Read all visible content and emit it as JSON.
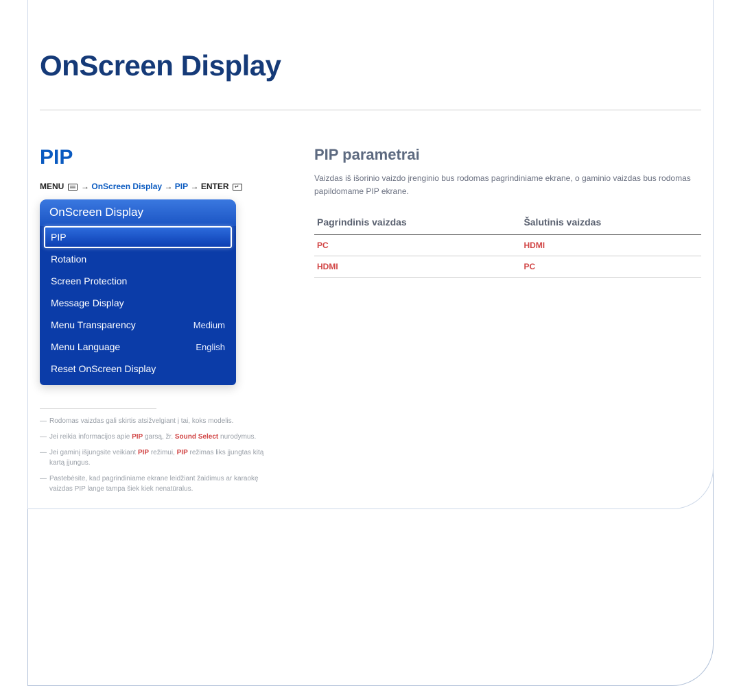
{
  "chapter_title": "OnScreen Display",
  "left": {
    "heading": "PIP",
    "breadcrumb": {
      "menu": "MENU",
      "path1": "OnScreen Display",
      "path2": "PIP",
      "enter": "ENTER",
      "arrow": "→"
    },
    "osd": {
      "title": "OnScreen Display",
      "items": [
        {
          "label": "PIP",
          "value": "",
          "selected": true
        },
        {
          "label": "Rotation",
          "value": "",
          "selected": false
        },
        {
          "label": "Screen Protection",
          "value": "",
          "selected": false
        },
        {
          "label": "Message Display",
          "value": "",
          "selected": false
        },
        {
          "label": "Menu Transparency",
          "value": "Medium",
          "selected": false
        },
        {
          "label": "Menu Language",
          "value": "English",
          "selected": false
        },
        {
          "label": "Reset OnScreen Display",
          "value": "",
          "selected": false
        }
      ]
    },
    "notes": {
      "n1": "Rodomas vaizdas gali skirtis atsižvelgiant į tai, koks modelis.",
      "n2_a": "Jei reikia informacijos apie ",
      "n2_hl1": "PIP",
      "n2_b": " garsą, žr. ",
      "n2_hl2": "Sound Select",
      "n2_c": " nurodymus.",
      "n3_a": "Jei gaminį išjungsite veikiant ",
      "n3_hl1": "PIP",
      "n3_b": " režimui, ",
      "n3_hl2": "PIP",
      "n3_c": " režimas liks įjungtas kitą kartą įjungus.",
      "n4": "Pastebėsite, kad pagrindiniame ekrane leidžiant žaidimus ar karaokę vaizdas PIP lange tampa šiek kiek nenatūralus."
    }
  },
  "right": {
    "heading": "PIP parametrai",
    "desc": "Vaizdas iš išorinio vaizdo įrenginio bus rodomas pagrindiniame ekrane, o gaminio vaizdas bus rodomas papildomame PIP ekrane.",
    "table": {
      "col1": "Pagrindinis vaizdas",
      "col2": "Šalutinis vaizdas",
      "rows": [
        {
          "c1": "PC",
          "c2": "HDMI"
        },
        {
          "c1": "HDMI",
          "c2": "PC"
        }
      ]
    }
  }
}
